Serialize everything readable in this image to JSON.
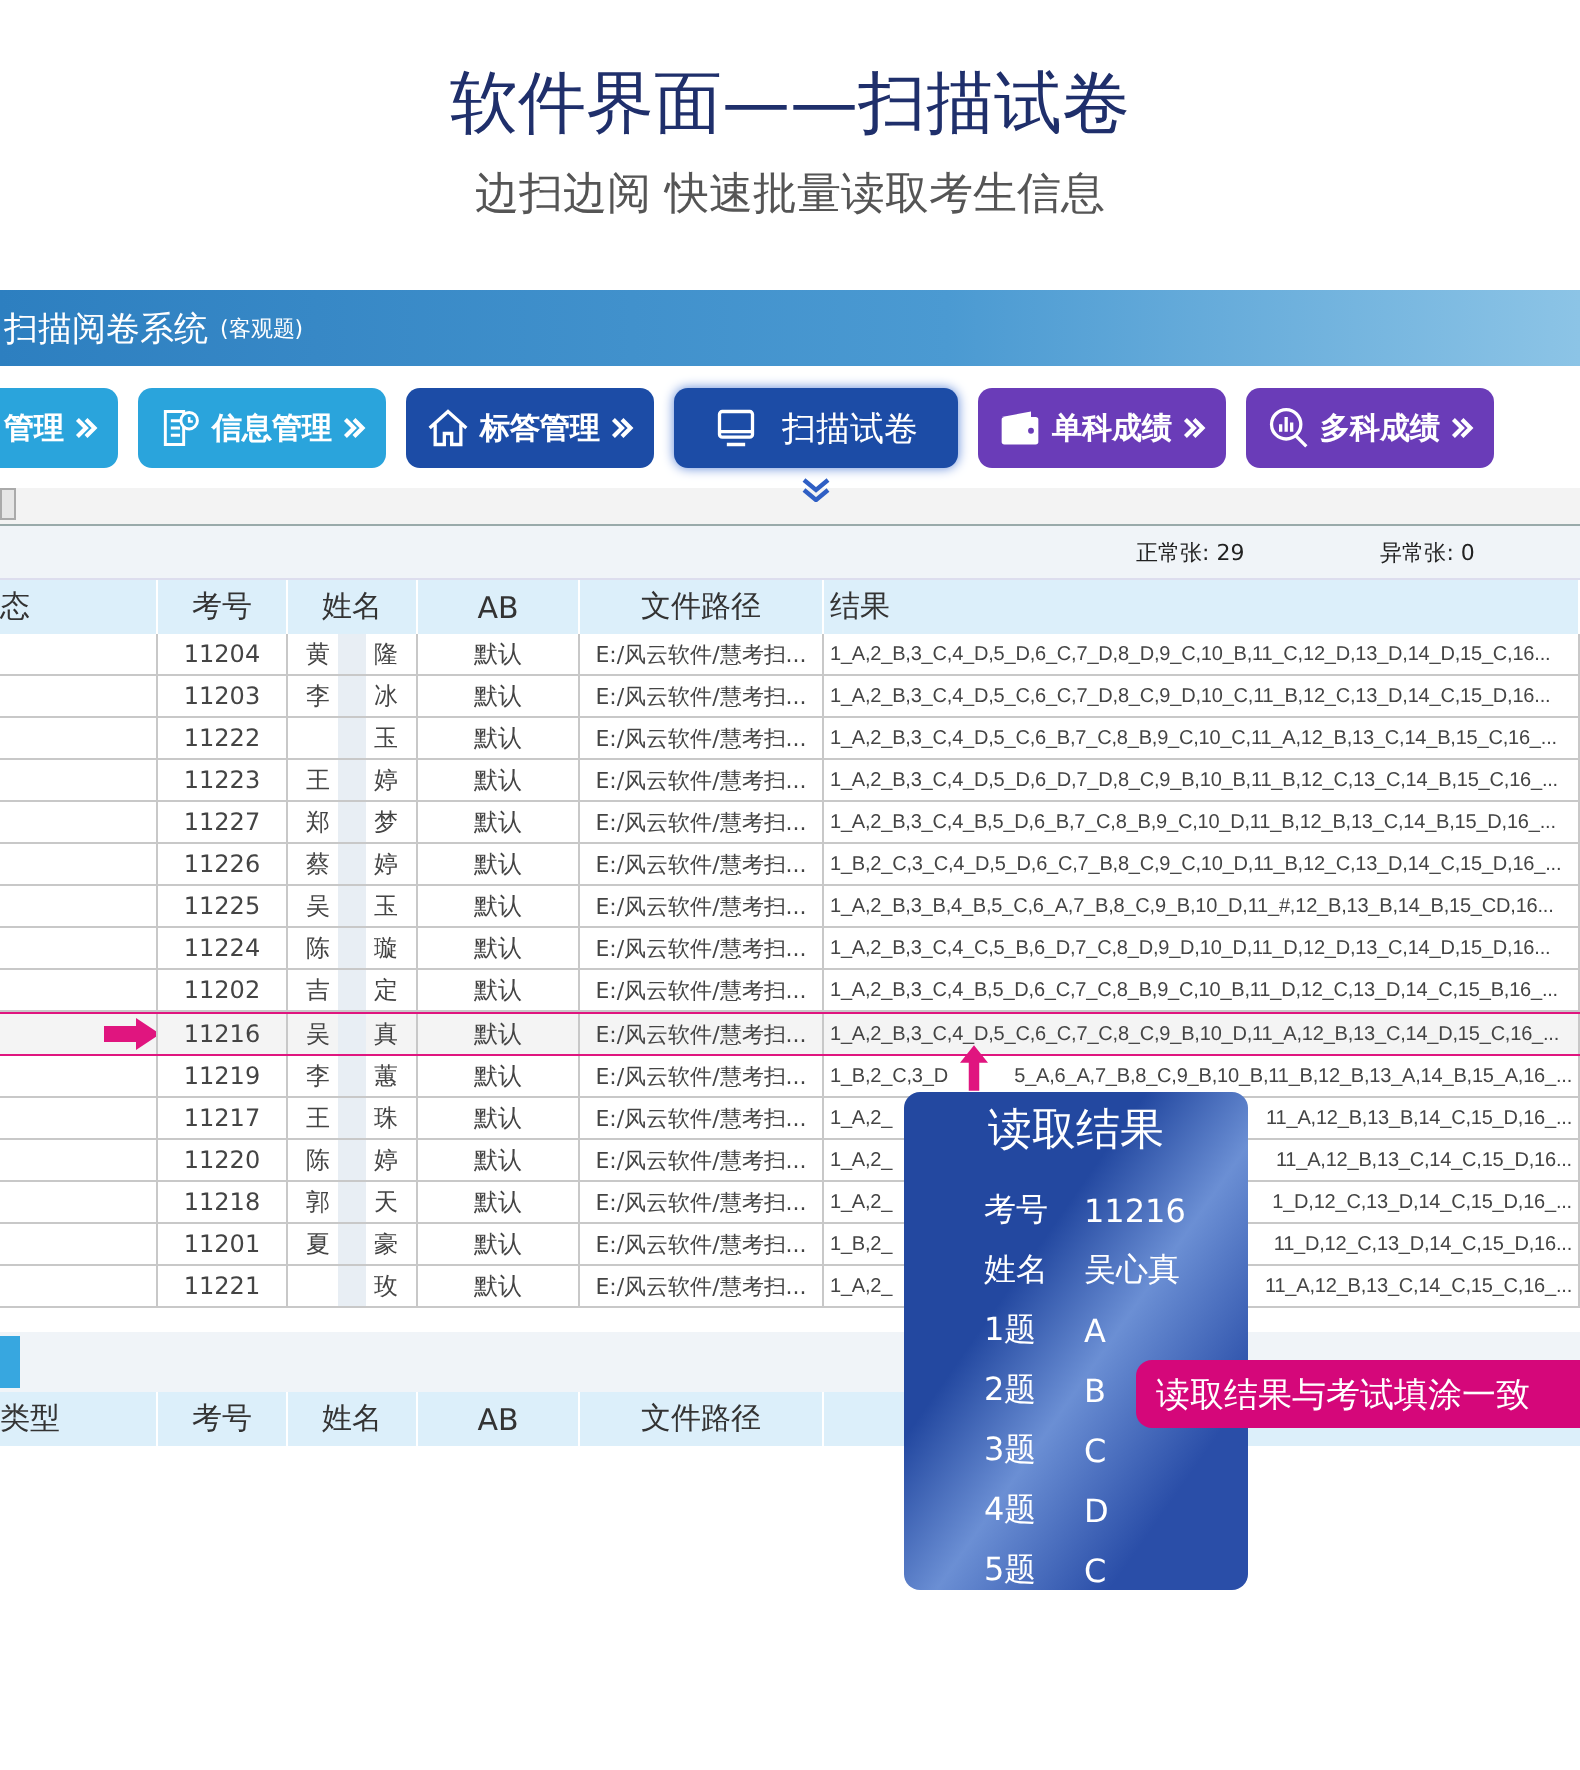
{
  "header": {
    "title": "软件界面——扫描试卷",
    "subtitle": "边扫边阅 快速批量读取考生信息"
  },
  "app_bar": {
    "title": "扫描阅卷系统",
    "subtitle": "(客观题)"
  },
  "nav": [
    {
      "label": "管理",
      "color": "#2aa4dc",
      "selected": false
    },
    {
      "label": "信息管理",
      "color": "#2aa4dc",
      "selected": false
    },
    {
      "label": "标答管理",
      "color": "#1c4ca6",
      "selected": false
    },
    {
      "label": "扫描试卷",
      "color": "#1c4ca6",
      "selected": true
    },
    {
      "label": "单科成绩",
      "color": "#6a3cb8",
      "selected": false
    },
    {
      "label": "多科成绩",
      "color": "#6a3cb8",
      "selected": false
    }
  ],
  "counts": [
    "正常张: 29",
    "异常张: 0"
  ],
  "table": {
    "columns": [
      "态",
      "考号",
      "姓名",
      "AB",
      "文件路径",
      "结果"
    ],
    "rows": [
      {
        "id": "11204",
        "name": [
          "黄",
          "隆"
        ],
        "ab": "默认",
        "path": "E:/风云软件/慧考扫...",
        "result": [
          "1_A,2_B,3_C,4_D,5_D,6_C,7_D,8_D,9_C,10_B,11_C,12_D,13_D,14_D,15_C,16..."
        ],
        "selected": false
      },
      {
        "id": "11203",
        "name": [
          "李",
          "冰"
        ],
        "ab": "默认",
        "path": "E:/风云软件/慧考扫...",
        "result": [
          "1_A,2_B,3_C,4_D,5_C,6_C,7_D,8_C,9_D,10_C,11_B,12_C,13_D,14_C,15_D,16..."
        ],
        "selected": false
      },
      {
        "id": "11222",
        "name": [
          "玉"
        ],
        "ab": "默认",
        "path": "E:/风云软件/慧考扫...",
        "result": [
          "1_A,2_B,3_C,4_D,5_C,6_B,7_C,8_B,9_C,10_C,11_A,12_B,13_C,14_B,15_C,16_..."
        ],
        "selected": false
      },
      {
        "id": "11223",
        "name": [
          "王",
          "婷"
        ],
        "ab": "默认",
        "path": "E:/风云软件/慧考扫...",
        "result": [
          "1_A,2_B,3_C,4_D,5_D,6_D,7_D,8_C,9_B,10_B,11_B,12_C,13_C,14_B,15_C,16_..."
        ],
        "selected": false
      },
      {
        "id": "11227",
        "name": [
          "郑",
          "梦"
        ],
        "ab": "默认",
        "path": "E:/风云软件/慧考扫...",
        "result": [
          "1_A,2_B,3_C,4_B,5_D,6_B,7_C,8_B,9_C,10_D,11_B,12_B,13_C,14_B,15_D,16_..."
        ],
        "selected": false
      },
      {
        "id": "11226",
        "name": [
          "蔡",
          "婷"
        ],
        "ab": "默认",
        "path": "E:/风云软件/慧考扫...",
        "result": [
          "1_B,2_C,3_C,4_D,5_D,6_C,7_B,8_C,9_C,10_D,11_B,12_C,13_D,14_C,15_D,16_..."
        ],
        "selected": false
      },
      {
        "id": "11225",
        "name": [
          "吴",
          "玉"
        ],
        "ab": "默认",
        "path": "E:/风云软件/慧考扫...",
        "result": [
          "1_A,2_B,3_B,4_B,5_C,6_A,7_B,8_C,9_B,10_D,11_#,12_B,13_B,14_B,15_CD,16..."
        ],
        "selected": false
      },
      {
        "id": "11224",
        "name": [
          "陈",
          "璇"
        ],
        "ab": "默认",
        "path": "E:/风云软件/慧考扫...",
        "result": [
          "1_A,2_B,3_C,4_C,5_B,6_D,7_C,8_D,9_D,10_D,11_D,12_D,13_C,14_D,15_D,16..."
        ],
        "selected": false
      },
      {
        "id": "11202",
        "name": [
          "吉",
          "定"
        ],
        "ab": "默认",
        "path": "E:/风云软件/慧考扫...",
        "result": [
          "1_A,2_B,3_C,4_B,5_D,6_C,7_C,8_B,9_C,10_B,11_D,12_C,13_D,14_C,15_B,16_..."
        ],
        "selected": false
      },
      {
        "id": "11216",
        "name": [
          "吴",
          "真"
        ],
        "ab": "默认",
        "path": "E:/风云软件/慧考扫...",
        "result": [
          "1_A,2_B,3_C,4_D,5_C,6_C,7_C,8_C,9_B,10_D,11_A,12_B,13_C,14_D,15_C,16_..."
        ],
        "selected": true
      },
      {
        "id": "11219",
        "name": [
          "李",
          "蕙"
        ],
        "ab": "默认",
        "path": "E:/风云软件/慧考扫...",
        "result": [
          "1_B,2_C,3_D",
          "5_A,6_A,7_B,8_C,9_B,10_B,11_B,12_B,13_A,14_B,15_A,16_..."
        ],
        "selected": false
      },
      {
        "id": "11217",
        "name": [
          "王",
          "珠"
        ],
        "ab": "默认",
        "path": "E:/风云软件/慧考扫...",
        "result": [
          "1_A,2_",
          "11_A,12_B,13_B,14_C,15_D,16_..."
        ],
        "selected": false
      },
      {
        "id": "11220",
        "name": [
          "陈",
          "婷"
        ],
        "ab": "默认",
        "path": "E:/风云软件/慧考扫...",
        "result": [
          "1_A,2_",
          "11_A,12_B,13_C,14_C,15_D,16..."
        ],
        "selected": false
      },
      {
        "id": "11218",
        "name": [
          "郭",
          "天"
        ],
        "ab": "默认",
        "path": "E:/风云软件/慧考扫...",
        "result": [
          "1_A,2_",
          "1_D,12_C,13_D,14_C,15_D,16_..."
        ],
        "selected": false
      },
      {
        "id": "11201",
        "name": [
          "夏",
          "豪"
        ],
        "ab": "默认",
        "path": "E:/风云软件/慧考扫...",
        "result": [
          "1_B,2_",
          "11_D,12_C,13_D,14_C,15_D,16..."
        ],
        "selected": false
      },
      {
        "id": "11221",
        "name": [
          "玫"
        ],
        "ab": "默认",
        "path": "E:/风云软件/慧考扫...",
        "result": [
          "1_A,2_",
          "11_A,12_B,13_C,14_C,15_C,16_..."
        ],
        "selected": false
      }
    ]
  },
  "bottom_table": {
    "columns": [
      "类型",
      "考号",
      "姓名",
      "AB",
      "文件路径"
    ]
  },
  "popup": {
    "title": "读取结果",
    "rows": [
      {
        "label": "考号",
        "value": "11216"
      },
      {
        "label": "姓名",
        "value": "吴心真"
      },
      {
        "label": "1题",
        "value": "A"
      },
      {
        "label": "2题",
        "value": "B"
      },
      {
        "label": "3题",
        "value": "C"
      },
      {
        "label": "4题",
        "value": "D"
      },
      {
        "label": "5题",
        "value": "C"
      }
    ]
  },
  "callout": "读取结果与考试填涂一致"
}
